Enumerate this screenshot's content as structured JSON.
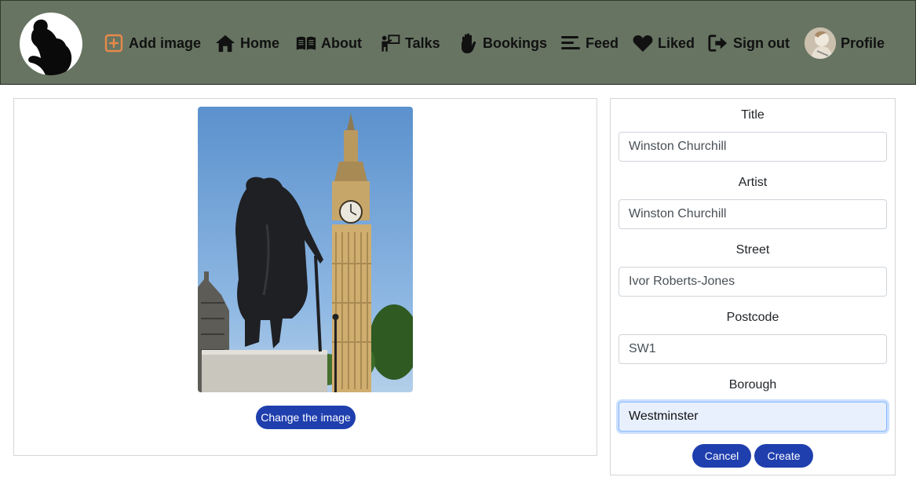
{
  "nav": {
    "items": [
      {
        "label": "Add image",
        "icon": "plus-square-icon"
      },
      {
        "label": "Home",
        "icon": "home-icon"
      },
      {
        "label": "About",
        "icon": "book-open-icon"
      },
      {
        "label": "Talks",
        "icon": "presenter-icon"
      },
      {
        "label": "Bookings",
        "icon": "hand-icon"
      },
      {
        "label": "Feed",
        "icon": "stream-icon"
      },
      {
        "label": "Liked",
        "icon": "heart-icon"
      },
      {
        "label": "Sign out",
        "icon": "sign-out-icon"
      },
      {
        "label": "Profile",
        "icon": "avatar"
      }
    ],
    "colors": {
      "background": "#677462",
      "add_accent": "#e8894a"
    }
  },
  "upload": {
    "change_label": "Change the image"
  },
  "form": {
    "fields": [
      {
        "label": "Title",
        "value": "Winston Churchill"
      },
      {
        "label": "Artist",
        "value": "Winston Churchill"
      },
      {
        "label": "Street",
        "value": "Ivor Roberts-Jones"
      },
      {
        "label": "Postcode",
        "value": "SW1"
      },
      {
        "label": "Borough",
        "value": "Westminster"
      }
    ],
    "cancel_label": "Cancel",
    "create_label": "Create"
  },
  "colors": {
    "button_primary": "#1f3fae"
  }
}
